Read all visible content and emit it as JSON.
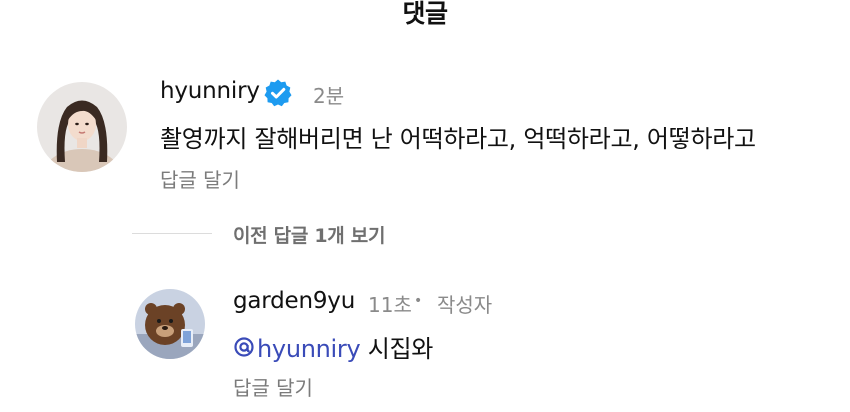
{
  "header": {
    "title": "댓글"
  },
  "comment": {
    "username": "hyunniry",
    "verified": true,
    "time": "2분",
    "text": "촬영까지 잘해버리면 난 어떡하라고, 억떡하라고, 어떻하라고",
    "reply_label": "답글 달기"
  },
  "replies_toggle": {
    "label": "이전 답글 1개 보기"
  },
  "reply": {
    "username": "garden9yu",
    "time": "11초",
    "separator": "•",
    "author_badge": "작성자",
    "mention": "hyunniry",
    "text": "시집와",
    "reply_label": "답글 달기"
  },
  "colors": {
    "verified_badge": "#1d9bf0",
    "mention": "#3a4bb8",
    "secondary_text": "#8a8a8a"
  },
  "icons": {
    "verified": "verified-badge-icon",
    "mention": "threads-at-icon"
  }
}
